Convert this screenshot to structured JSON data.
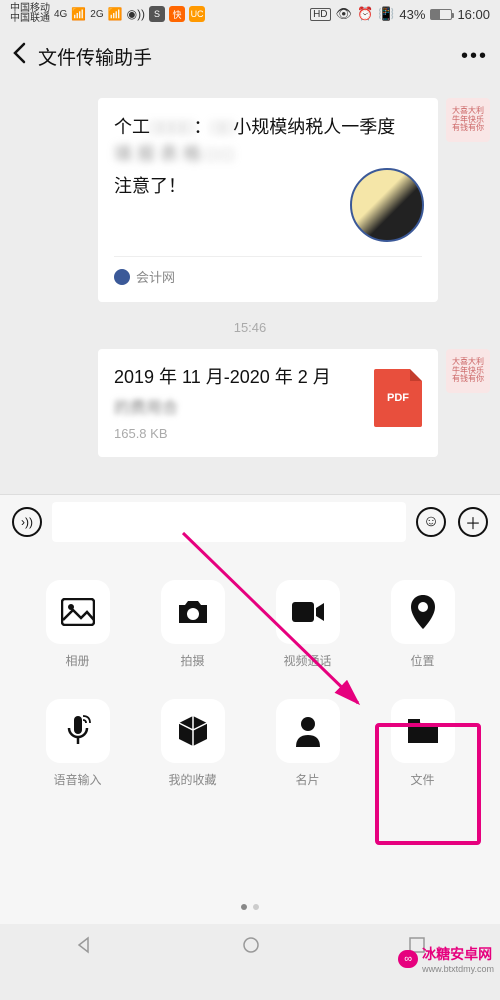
{
  "status": {
    "carrier1": "中国移动",
    "carrier2": "中国联通",
    "net1": "4G",
    "net2": "2G",
    "hd": "HD",
    "battery_pct": "43%",
    "time": "16:00"
  },
  "nav": {
    "title": "文件传输助手"
  },
  "msg1": {
    "line1_a": "个工",
    "line1_b": "小规模纳税人一季度",
    "extra": "注意了！",
    "source": "会计网"
  },
  "timestamp": "15:46",
  "msg2": {
    "title": "2019 年 11 月-2020 年 2 月",
    "subtitle": "的费用合",
    "size": "165.8 KB",
    "filetype": "PDF"
  },
  "panel": {
    "row1": [
      {
        "name": "album",
        "label": "相册"
      },
      {
        "name": "camera",
        "label": "拍摄"
      },
      {
        "name": "video-call",
        "label": "视频通话"
      },
      {
        "name": "location",
        "label": "位置"
      }
    ],
    "row2": [
      {
        "name": "voice-input",
        "label": "语音输入"
      },
      {
        "name": "favorites",
        "label": "我的收藏"
      },
      {
        "name": "contact-card",
        "label": "名片"
      },
      {
        "name": "file",
        "label": "文件"
      }
    ]
  },
  "watermark": "冰糖安卓网",
  "watermark_url": "www.btxtdmy.com"
}
